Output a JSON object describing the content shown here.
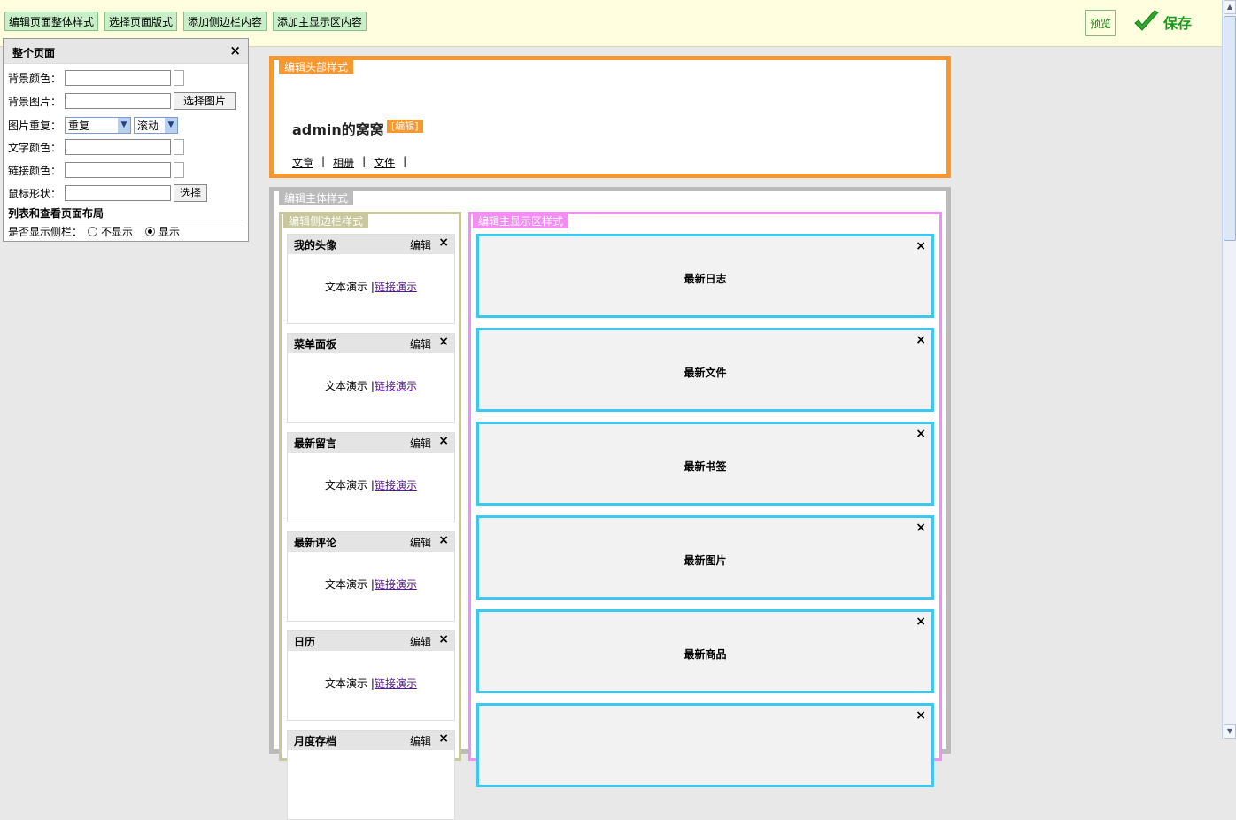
{
  "toolbar": {
    "buttons": [
      "编辑页面整体样式",
      "选择页面版式",
      "添加侧边栏内容",
      "添加主显示区内容"
    ],
    "preview_label": "预览",
    "save_label": "保存"
  },
  "panel": {
    "title": "整个页面",
    "close": "×",
    "bg_color_label": "背景颜色：",
    "bg_image_label": "背景图片：",
    "choose_image_button": "选择图片",
    "repeat_label": "图片重复：",
    "repeat_value": "重复",
    "scroll_value": "滚动",
    "text_color_label": "文字颜色：",
    "link_color_label": "链接颜色：",
    "cursor_label": "鼠标形状：",
    "choose_button": "选择",
    "layout_heading": "列表和查看页面布局",
    "sidebar_label": "是否显示侧栏：",
    "hide_option": "不显示",
    "show_option": "显示"
  },
  "header": {
    "tag": "编辑头部样式",
    "site_title": "admin的窝窝",
    "edit_label": "[编辑]",
    "nav": [
      "文章",
      "相册",
      "文件"
    ],
    "separator": "|"
  },
  "main": {
    "tag": "编辑主体样式",
    "sidebar_tag": "编辑侧边栏样式",
    "content_tag": "编辑主显示区样式",
    "edit_label": "编辑",
    "close": "×",
    "demo_text": "文本演示",
    "demo_sep": "|",
    "demo_link": "链接演示",
    "widgets": [
      "我的头像",
      "菜单面板",
      "最新留言",
      "最新评论",
      "日历",
      "月度存档"
    ],
    "blocks": [
      "最新日志",
      "最新文件",
      "最新书签",
      "最新图片",
      "最新商品",
      ""
    ]
  },
  "colors": {
    "header_border": "#f7972f",
    "body_border": "#bbbbbb",
    "sidebar_border": "#c8c89c",
    "content_border": "#f48ef4",
    "block_border": "#3cc8f0",
    "toolbar_bg": "#ffffe0"
  }
}
